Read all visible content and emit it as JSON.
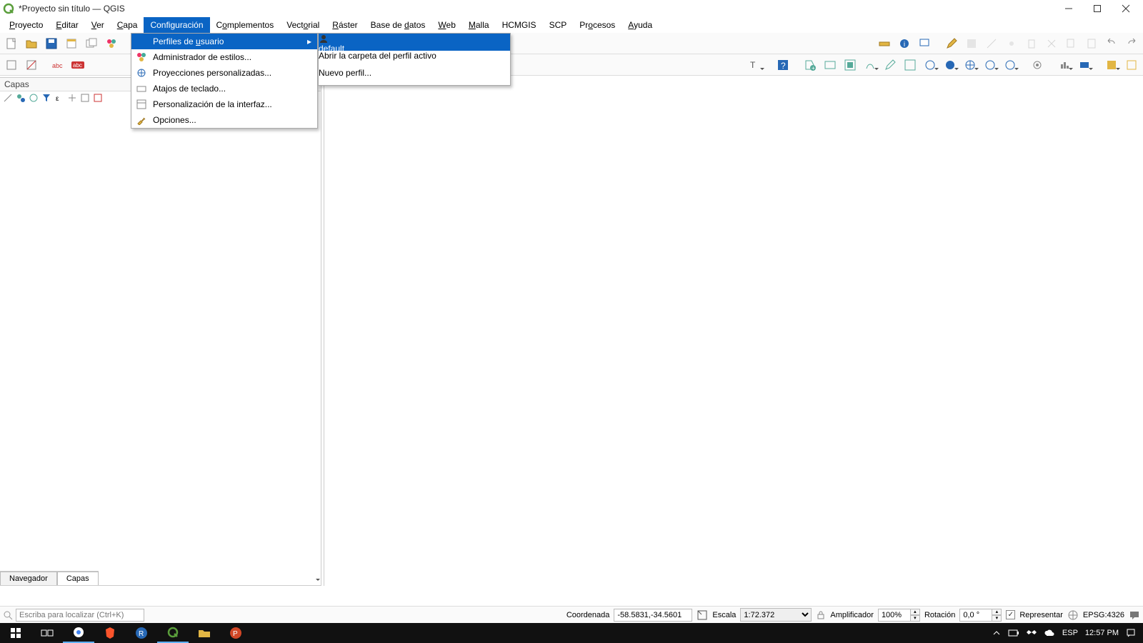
{
  "window": {
    "title": "*Proyecto sin título — QGIS"
  },
  "menubar": {
    "proyecto": "Proyecto",
    "editar": "Editar",
    "ver": "Ver",
    "capa": "Capa",
    "configuracion": "Configuración",
    "complementos": "Complementos",
    "vectorial": "Vectorial",
    "raster": "Ráster",
    "basedatos": "Base de datos",
    "web": "Web",
    "malla": "Malla",
    "hcmgis": "HCMGIS",
    "scp": "SCP",
    "procesos": "Procesos",
    "ayuda": "Ayuda"
  },
  "dropdown": {
    "perfiles": "Perfiles de usuario",
    "admin_estilos": "Administrador de estilos...",
    "proyecciones": "Proyecciones personalizadas...",
    "atajos": "Atajos de teclado...",
    "personalizacion": "Personalización de la interfaz...",
    "opciones": "Opciones..."
  },
  "submenu": {
    "default": "default",
    "abrir": "Abrir la carpeta del perfil activo",
    "nuevo": "Nuevo perfil..."
  },
  "panel": {
    "title": "Capas",
    "tabs": {
      "navegador": "Navegador",
      "capas": "Capas"
    }
  },
  "status": {
    "locator": "Escriba para localizar (Ctrl+K)",
    "coord_label": "Coordenada",
    "coord_value": "-58.5831,-34.5601",
    "escala_label": "Escala",
    "escala_value": "1:72.372",
    "amplificador_label": "Amplificador",
    "amplificador_value": "100%",
    "rotacion_label": "Rotación",
    "rotacion_value": "0,0 °",
    "representar": "Representar",
    "epsg": "EPSG:4326"
  },
  "taskbar": {
    "lang": "ESP",
    "time": "12:57 PM"
  }
}
